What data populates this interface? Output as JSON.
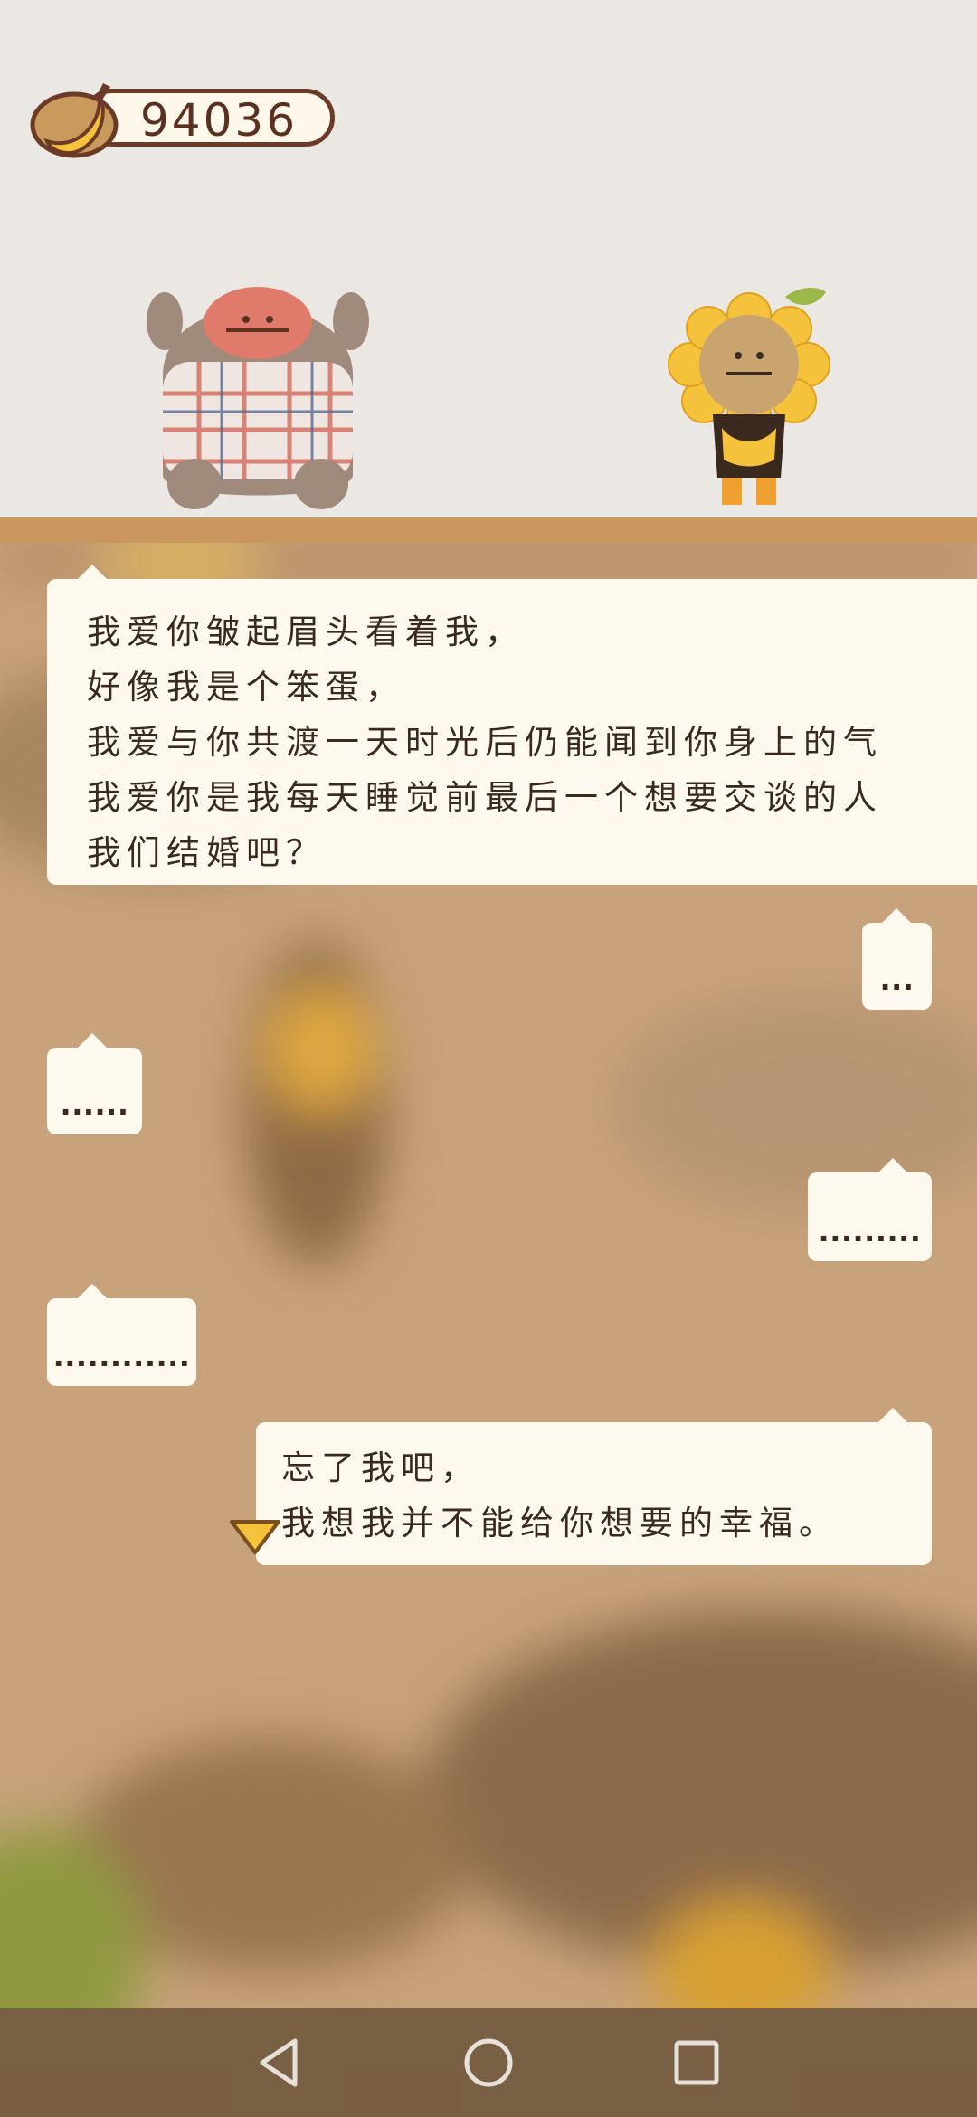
{
  "hud": {
    "banana_count": "94036",
    "banana_icon": "banana-icon"
  },
  "characters": {
    "left": "gorilla-in-plaid-shirt",
    "right": "monkey-in-sunflower-costume"
  },
  "dialogue": {
    "message_1": "我爱你皱起眉头看着我，\n好像我是个笨蛋，\n我爱与你共渡一天时光后仍能闻到你身上的气\n我爱你是我每天睡觉前最后一个想要交谈的人\n我们结婚吧？",
    "reply_1": "...",
    "message_2": "......",
    "reply_2": ".........",
    "message_3": "............",
    "reply_3": "忘了我吧，\n我想我并不能给你想要的幸福。"
  },
  "navigation": {
    "back_icon": "back-triangle-icon",
    "home_icon": "home-circle-icon",
    "recents_icon": "recents-square-icon"
  },
  "colors": {
    "stage_bg": "#ebe7e2",
    "shelf": "#c8965e",
    "bubble": "#fdf9ee",
    "scene_bg": "#c7a27a",
    "accent_yellow": "#f5c33b"
  }
}
